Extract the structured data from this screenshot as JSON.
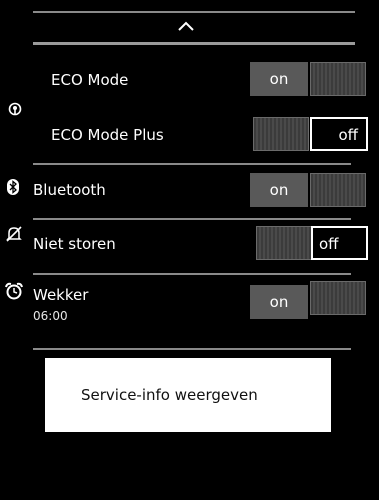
{
  "header": {
    "collapse_icon": "chevron-up-icon"
  },
  "rows": {
    "eco_mode": {
      "label": "ECO Mode",
      "state": "on",
      "icon": "radiation-icon"
    },
    "eco_mode_plus": {
      "label": "ECO Mode Plus",
      "state": "off"
    },
    "bluetooth": {
      "label": "Bluetooth",
      "state": "on",
      "icon": "bluetooth-icon"
    },
    "niet_storen": {
      "label": "Niet storen",
      "state": "off",
      "icon": "bell-muted-icon"
    },
    "wekker": {
      "label": "Wekker",
      "sub": "06:00",
      "state": "on",
      "icon": "alarm-clock-icon"
    }
  },
  "service_button": {
    "label": "Service-info weergeven"
  },
  "colors": {
    "background": "#000000",
    "toggle_on_bg": "#595959",
    "divider": "#8a8a8a",
    "button_bg": "#ffffff"
  }
}
